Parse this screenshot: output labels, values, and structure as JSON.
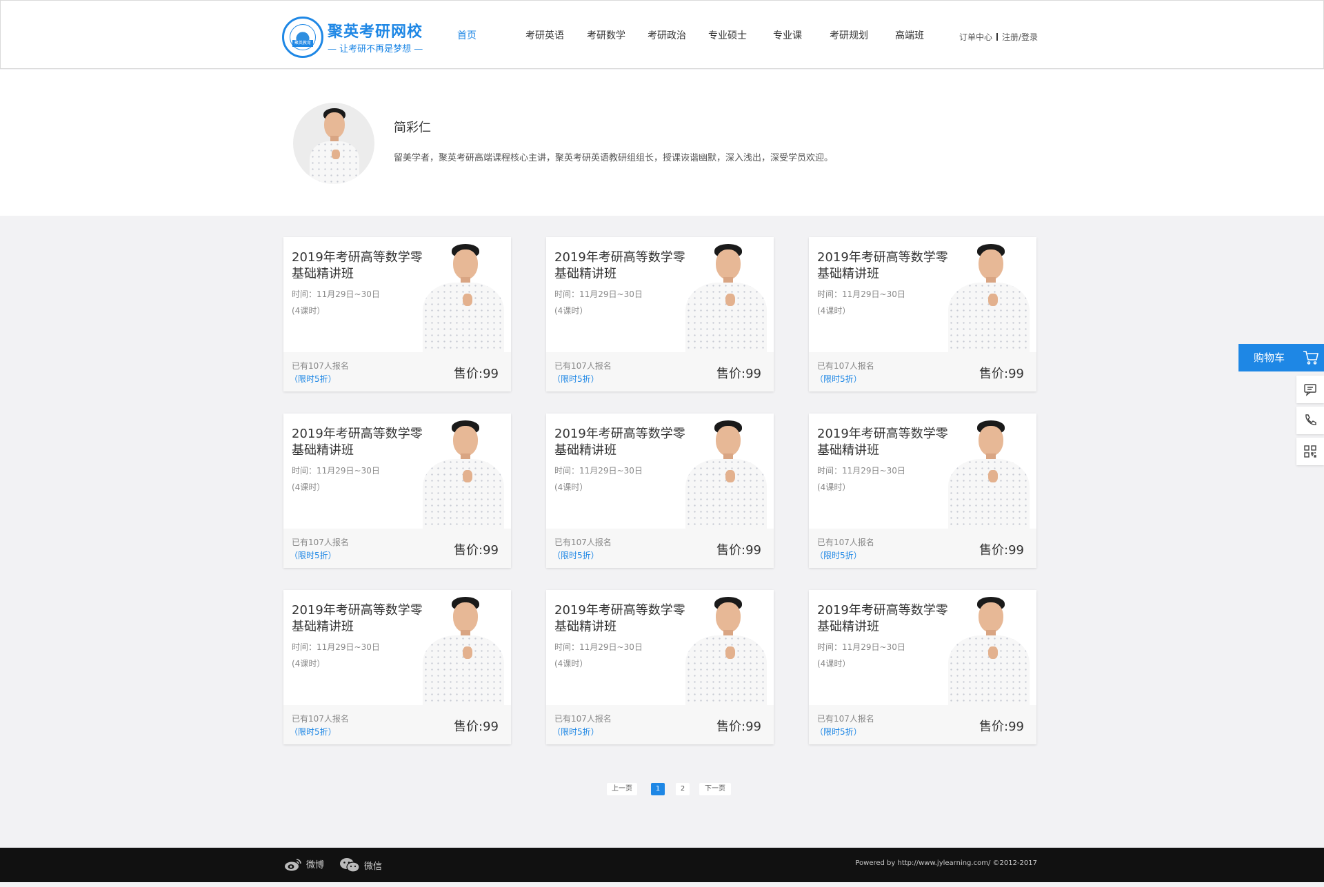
{
  "header": {
    "logo_name": "聚英考研网校",
    "logo_slogan": "— 让考研不再是梦想 —",
    "logo_seal_text": "聚英教育",
    "nav": [
      "首页",
      "考研英语",
      "考研数学",
      "考研政治",
      "专业硕士",
      "专业课",
      "考研规划",
      "高端班"
    ],
    "active_nav": "首页",
    "order_center": "订单中心",
    "register_login": "注册/登录"
  },
  "teacher": {
    "name": "简彩仁",
    "description": "留美学者，聚英考研高端课程核心主讲，聚英考研英语教研组组长，授课诙谐幽默，深入浅出，深受学员欢迎。"
  },
  "courses": [
    {
      "title": "2019年考研高等数学零基础精讲班",
      "time": "时间：11月29日~30日",
      "hours": "(4课时）",
      "enrolled": "已有107人报名",
      "discount": "（限时5折）",
      "price": "售价:99"
    },
    {
      "title": "2019年考研高等数学零基础精讲班",
      "time": "时间：11月29日~30日",
      "hours": "(4课时）",
      "enrolled": "已有107人报名",
      "discount": "（限时5折）",
      "price": "售价:99"
    },
    {
      "title": "2019年考研高等数学零基础精讲班",
      "time": "时间：11月29日~30日",
      "hours": "(4课时）",
      "enrolled": "已有107人报名",
      "discount": "（限时5折）",
      "price": "售价:99"
    },
    {
      "title": "2019年考研高等数学零基础精讲班",
      "time": "时间：11月29日~30日",
      "hours": "(4课时）",
      "enrolled": "已有107人报名",
      "discount": "（限时5折）",
      "price": "售价:99"
    },
    {
      "title": "2019年考研高等数学零基础精讲班",
      "time": "时间：11月29日~30日",
      "hours": "(4课时）",
      "enrolled": "已有107人报名",
      "discount": "（限时5折）",
      "price": "售价:99"
    },
    {
      "title": "2019年考研高等数学零基础精讲班",
      "time": "时间：11月29日~30日",
      "hours": "(4课时）",
      "enrolled": "已有107人报名",
      "discount": "（限时5折）",
      "price": "售价:99"
    },
    {
      "title": "2019年考研高等数学零基础精讲班",
      "time": "时间：11月29日~30日",
      "hours": "(4课时）",
      "enrolled": "已有107人报名",
      "discount": "（限时5折）",
      "price": "售价:99"
    },
    {
      "title": "2019年考研高等数学零基础精讲班",
      "time": "时间：11月29日~30日",
      "hours": "(4课时）",
      "enrolled": "已有107人报名",
      "discount": "（限时5折）",
      "price": "售价:99"
    },
    {
      "title": "2019年考研高等数学零基础精讲班",
      "time": "时间：11月29日~30日",
      "hours": "(4课时）",
      "enrolled": "已有107人报名",
      "discount": "（限时5折）",
      "price": "售价:99"
    }
  ],
  "pagination": {
    "prev": "上一页",
    "pages": [
      "1",
      "2"
    ],
    "current": "1",
    "next": "下一页"
  },
  "side": {
    "cart_label": "购物车",
    "icons": [
      "cart-icon",
      "message-icon",
      "phone-icon",
      "qrcode-icon"
    ]
  },
  "footer": {
    "weibo": "微博",
    "wechat": "微信",
    "copyright": "Powered by http://www.jylearning.com/ ©2012-2017"
  },
  "colors": {
    "accent": "#1e87e5",
    "footer_bg": "#111111",
    "page_bg": "#f2f2f4"
  }
}
